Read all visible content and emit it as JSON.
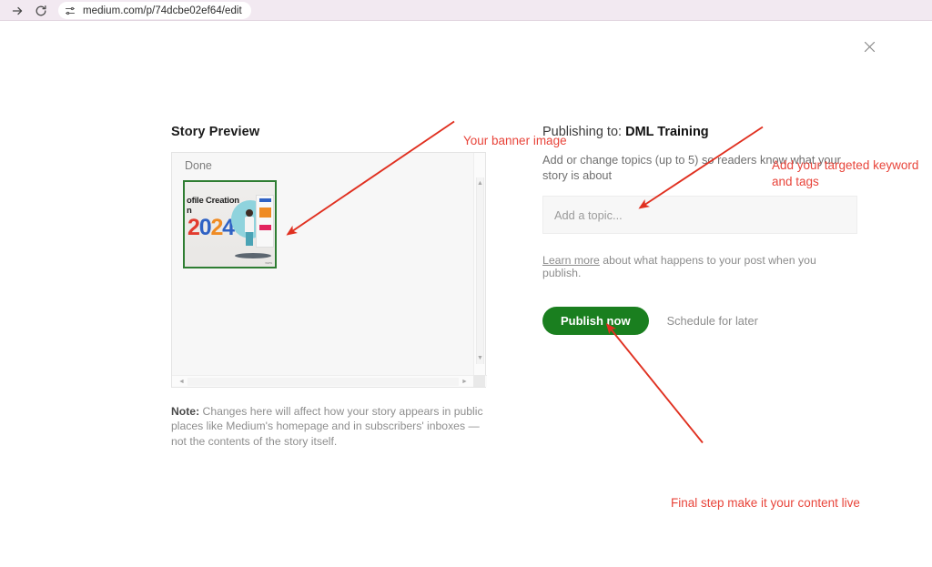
{
  "browser": {
    "forward_icon": "forward-arrow-icon",
    "reload_icon": "reload-icon",
    "tune_icon": "tune-icon",
    "url": "medium.com/p/74dcbe02ef64/edit"
  },
  "dialog": {
    "close_icon": "close-icon"
  },
  "left": {
    "heading": "Story Preview",
    "done_label": "Done",
    "banner": {
      "title_line1": "ofile Creation",
      "title_line2": "n",
      "year_chars": [
        "2",
        "0",
        "2",
        "4"
      ],
      "credit": "www"
    },
    "scroll": {
      "up_arrow": "▲",
      "down_arrow": "▼",
      "left_arrow": "◄",
      "right_arrow": "►"
    },
    "note_label": "Note:",
    "note_body": " Changes here will affect how your story appears in public places like Medium's homepage and in subscribers' inboxes — not the contents of the story itself."
  },
  "right": {
    "publishing_prefix": "Publishing to: ",
    "publication_name": "DML Training",
    "topics_description": "Add or change topics (up to 5) so readers know what your story is about",
    "topic_placeholder": "Add a topic...",
    "learn_more_label": "Learn more",
    "learn_more_rest": " about what happens to your post when you publish.",
    "publish_label": "Publish now",
    "schedule_label": "Schedule for later"
  },
  "annotations": {
    "banner": "Your banner image",
    "keyword": "Add your targeted keyword and tags",
    "final": "Final step make it your content live",
    "color": "#e8443a"
  },
  "colors": {
    "chrome_bg": "#f2e9f1",
    "publish_green": "#1a7f1f",
    "banner_border": "#2e7d32",
    "annotation_red": "#e8443a"
  }
}
